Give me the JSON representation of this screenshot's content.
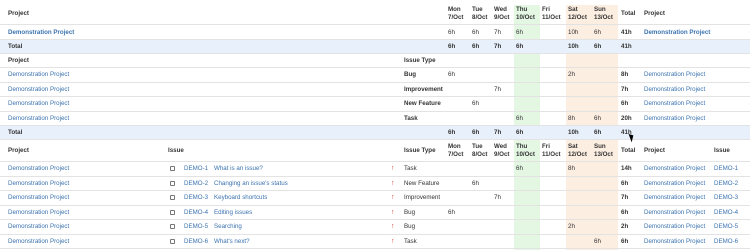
{
  "days": [
    {
      "dow": "Mon",
      "date": "7/Oct"
    },
    {
      "dow": "Tue",
      "date": "8/Oct"
    },
    {
      "dow": "Wed",
      "date": "9/Oct"
    },
    {
      "dow": "Thu",
      "date": "10/Oct"
    },
    {
      "dow": "Fri",
      "date": "11/Oct"
    },
    {
      "dow": "Sat",
      "date": "12/Oct"
    },
    {
      "dow": "Sun",
      "date": "13/Oct"
    }
  ],
  "labels": {
    "project": "Project",
    "issue": "Issue",
    "issue_type": "Issue Type",
    "total": "Total"
  },
  "section1": {
    "row": {
      "project": "Demonstration Project",
      "values": [
        "6h",
        "6h",
        "7h",
        "6h",
        "",
        "10h",
        "6h"
      ],
      "total": "41h",
      "right_project": "Demonstration Project"
    },
    "total": {
      "label": "Total",
      "values": [
        "6h",
        "6h",
        "7h",
        "6h",
        "",
        "10h",
        "6h"
      ],
      "total": "41h"
    }
  },
  "section2": {
    "rows": [
      {
        "project": "Demonstration Project",
        "type": "Bug",
        "values": [
          "6h",
          "",
          "",
          "",
          "",
          "2h",
          ""
        ],
        "total": "8h",
        "right_project": "Demonstration Project"
      },
      {
        "project": "Demonstration Project",
        "type": "Improvement",
        "values": [
          "",
          "",
          "7h",
          "",
          "",
          "",
          ""
        ],
        "total": "7h",
        "right_project": "Demonstration Project"
      },
      {
        "project": "Demonstration Project",
        "type": "New Feature",
        "values": [
          "",
          "6h",
          "",
          "",
          "",
          "",
          ""
        ],
        "total": "6h",
        "right_project": "Demonstration Project"
      },
      {
        "project": "Demonstration Project",
        "type": "Task",
        "values": [
          "",
          "",
          "",
          "6h",
          "",
          "8h",
          "6h"
        ],
        "total": "20h",
        "right_project": "Demonstration Project"
      }
    ],
    "total": {
      "label": "Total",
      "values": [
        "6h",
        "6h",
        "7h",
        "6h",
        "",
        "10h",
        "6h"
      ],
      "total": "41h"
    }
  },
  "section3": {
    "rows": [
      {
        "project": "Demonstration Project",
        "key": "DEMO-1",
        "summary": "What is an issue?",
        "type": "Task",
        "values": [
          "",
          "",
          "",
          "6h",
          "",
          "8h",
          ""
        ],
        "total": "14h",
        "right_project": "Demonstration Project",
        "right_issue": "DEMO-1",
        "icon": "task-icon"
      },
      {
        "project": "Demonstration Project",
        "key": "DEMO-2",
        "summary": "Changing an issue's status",
        "type": "New Feature",
        "values": [
          "",
          "6h",
          "",
          "",
          "",
          "",
          ""
        ],
        "total": "6h",
        "right_project": "Demonstration Project",
        "right_issue": "DEMO-2",
        "icon": "new-feature-icon"
      },
      {
        "project": "Demonstration Project",
        "key": "DEMO-3",
        "summary": "Keyboard shortcuts",
        "type": "Improvement",
        "values": [
          "",
          "",
          "7h",
          "",
          "",
          "",
          ""
        ],
        "total": "7h",
        "right_project": "Demonstration Project",
        "right_issue": "DEMO-3",
        "icon": "improvement-icon"
      },
      {
        "project": "Demonstration Project",
        "key": "DEMO-4",
        "summary": "Editing issues",
        "type": "Bug",
        "values": [
          "6h",
          "",
          "",
          "",
          "",
          "",
          ""
        ],
        "total": "6h",
        "right_project": "Demonstration Project",
        "right_issue": "DEMO-4",
        "icon": "bug-icon"
      },
      {
        "project": "Demonstration Project",
        "key": "DEMO-5",
        "summary": "Searching",
        "type": "Bug",
        "values": [
          "",
          "",
          "",
          "",
          "",
          "2h",
          ""
        ],
        "total": "2h",
        "right_project": "Demonstration Project",
        "right_issue": "DEMO-5",
        "icon": "bug-icon"
      },
      {
        "project": "Demonstration Project",
        "key": "DEMO-6",
        "summary": "What's next?",
        "type": "Task",
        "values": [
          "",
          "",
          "",
          "",
          "",
          "",
          "6h"
        ],
        "total": "6h",
        "right_project": "Demonstration Project",
        "right_issue": "DEMO-6",
        "icon": "task-icon"
      }
    ]
  },
  "colors": {
    "link": "#3b73af",
    "total_bg": "#e8f0fb",
    "today_bg": "#e3f7e3",
    "weekend_bg": "#fdeee2",
    "priority": "#d04437"
  },
  "priority_glyph": "↑"
}
